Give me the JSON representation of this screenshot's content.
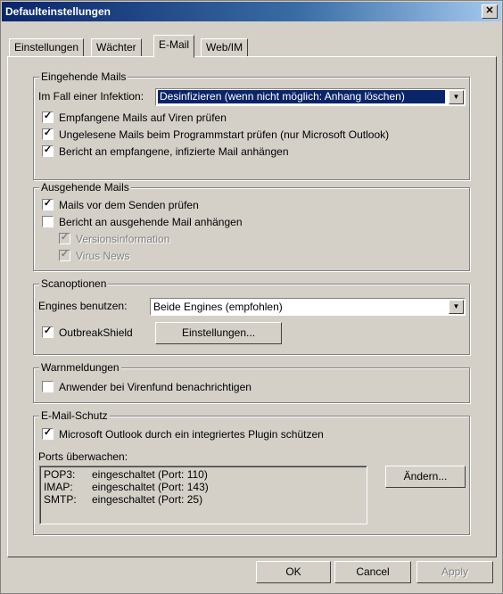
{
  "window": {
    "title": "Defaulteinstellungen"
  },
  "tabs": [
    {
      "label": "Einstellungen"
    },
    {
      "label": "Wächter"
    },
    {
      "label": "E-Mail"
    },
    {
      "label": "Web/IM"
    }
  ],
  "incoming": {
    "legend": "Eingehende Mails",
    "infection_label": "Im Fall einer Infektion:",
    "infection_value": "Desinfizieren (wenn nicht möglich: Anhang löschen)",
    "check_received": "Empfangene Mails auf Viren prüfen",
    "check_unread": "Ungelesene Mails beim Programmstart prüfen  (nur Microsoft Outlook)",
    "attach_report": "Bericht an empfangene, infizierte Mail anhängen"
  },
  "outgoing": {
    "legend": "Ausgehende Mails",
    "check_before_send": "Mails vor dem Senden prüfen",
    "attach_report": "Bericht an ausgehende Mail anhängen",
    "version_info": "Versionsinformation",
    "virus_news": "Virus News"
  },
  "scan": {
    "legend": "Scanoptionen",
    "engines_label": "Engines benutzen:",
    "engines_value": "Beide Engines (empfohlen)",
    "outbreak_label": "OutbreakShield",
    "settings_button": "Einstellungen..."
  },
  "warnings": {
    "legend": "Warnmeldungen",
    "notify_user": "Anwender bei Virenfund benachrichtigen"
  },
  "protection": {
    "legend": "E-Mail-Schutz",
    "outlook_plugin": "Microsoft Outlook durch ein integriertes Plugin schützen",
    "ports_label": "Ports überwachen:",
    "ports": [
      {
        "name": "POP3:",
        "status": "eingeschaltet (Port: 110)"
      },
      {
        "name": "IMAP:",
        "status": "eingeschaltet (Port: 143)"
      },
      {
        "name": "SMTP:",
        "status": "eingeschaltet (Port: 25)"
      }
    ],
    "change_button": "Ändern..."
  },
  "footer": {
    "ok": "OK",
    "cancel": "Cancel",
    "apply": "Apply"
  }
}
